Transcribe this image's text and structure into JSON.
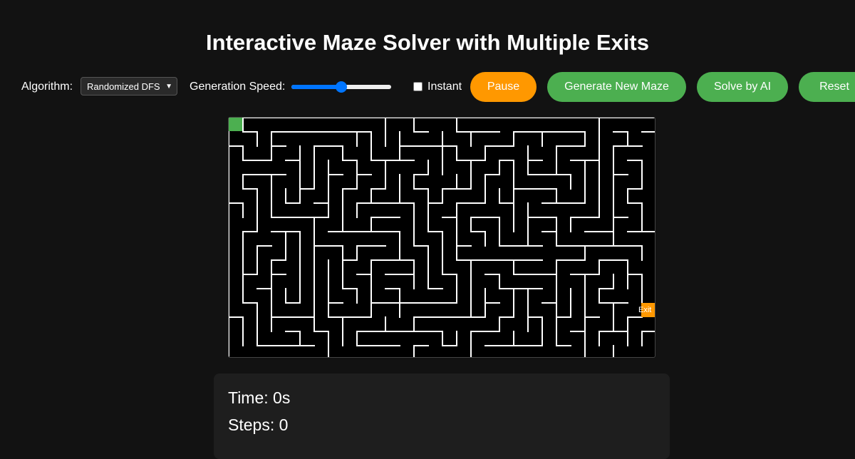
{
  "page": {
    "title": "Interactive Maze Solver with Multiple Exits"
  },
  "controls": {
    "algorithm_label": "Algorithm:",
    "algorithm_value": "Randomized DFS",
    "speed_label": "Generation Speed:",
    "speed_fraction": 0.5,
    "instant_label": "Instant",
    "instant_checked": false,
    "pause_label": "Pause",
    "generate_label": "Generate New Maze",
    "solve_label": "Solve by AI",
    "reset_label": "Reset"
  },
  "maze": {
    "exit_label": "Exit"
  },
  "stats": {
    "time": "Time: 0s",
    "steps": "Steps: 0"
  },
  "colors": {
    "background": "#121212",
    "start": "#4caf50",
    "exit": "#ff9800",
    "button_green": "#4caf50",
    "button_orange": "#ff9800",
    "slider": "#0075ff"
  }
}
